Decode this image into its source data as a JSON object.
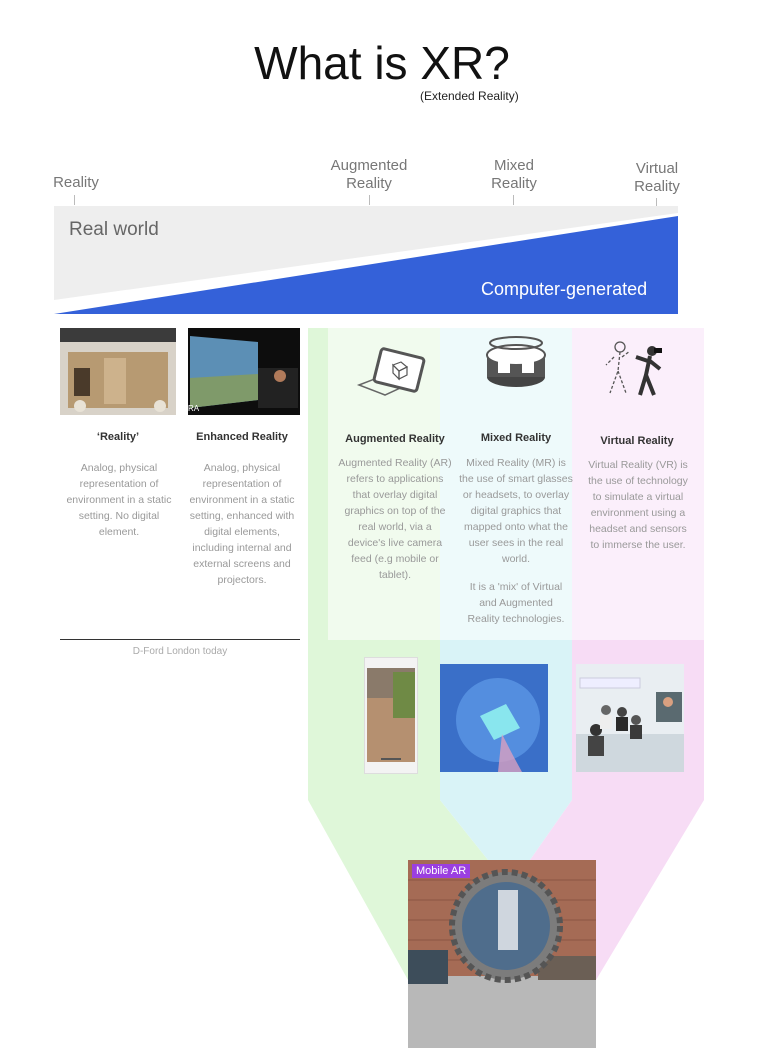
{
  "header": {
    "title": "What is XR?",
    "subtitle": "(Extended Reality)"
  },
  "spectrum": {
    "labels": [
      "Reality",
      "Augmented Reality",
      "Mixed Reality",
      "Virtual Reality"
    ],
    "real_world": "Real world",
    "computer_generated": "Computer-generated"
  },
  "columns": {
    "reality": {
      "caption": "‘Reality’",
      "description": "Analog, physical representation of environment in a static setting. No digital element."
    },
    "enhanced": {
      "caption": "Enhanced Reality",
      "description": "Analog, physical representation of environment in a static setting, enhanced with digital elements, including internal and external screens and projectors."
    },
    "ar": {
      "caption": "Augmented Reality",
      "description": "Augmented Reality (AR) refers to applications that overlay digital graphics on top of the real world, via a device's live camera feed (e.g mobile or tablet)."
    },
    "mr": {
      "caption": "Mixed Reality",
      "description": "Mixed Reality (MR) is the use of smart glasses or headsets, to overlay digital graphics that mapped onto what the user sees in the real world.",
      "description2": "It is a 'mix' of Virtual and Augmented Reality technologies."
    },
    "vr": {
      "caption": "Virtual Reality",
      "description": "Virtual Reality (VR) is the use of technology to simulate a virtual environment using a headset and sensors to immerse the user."
    }
  },
  "footer_note": "D-Ford London today",
  "enhanced_photo_tag": "RA",
  "bottom_photo_badge": "Mobile AR",
  "colors": {
    "title": "#111111",
    "real_world_band": "#eeeeee",
    "computer_generated_band": "#3461d9",
    "ar_tint": "#dff7d9",
    "mr_tint": "#d9f3f7",
    "vr_tint": "#f7dcf5",
    "badge": "#9b3fe0"
  }
}
